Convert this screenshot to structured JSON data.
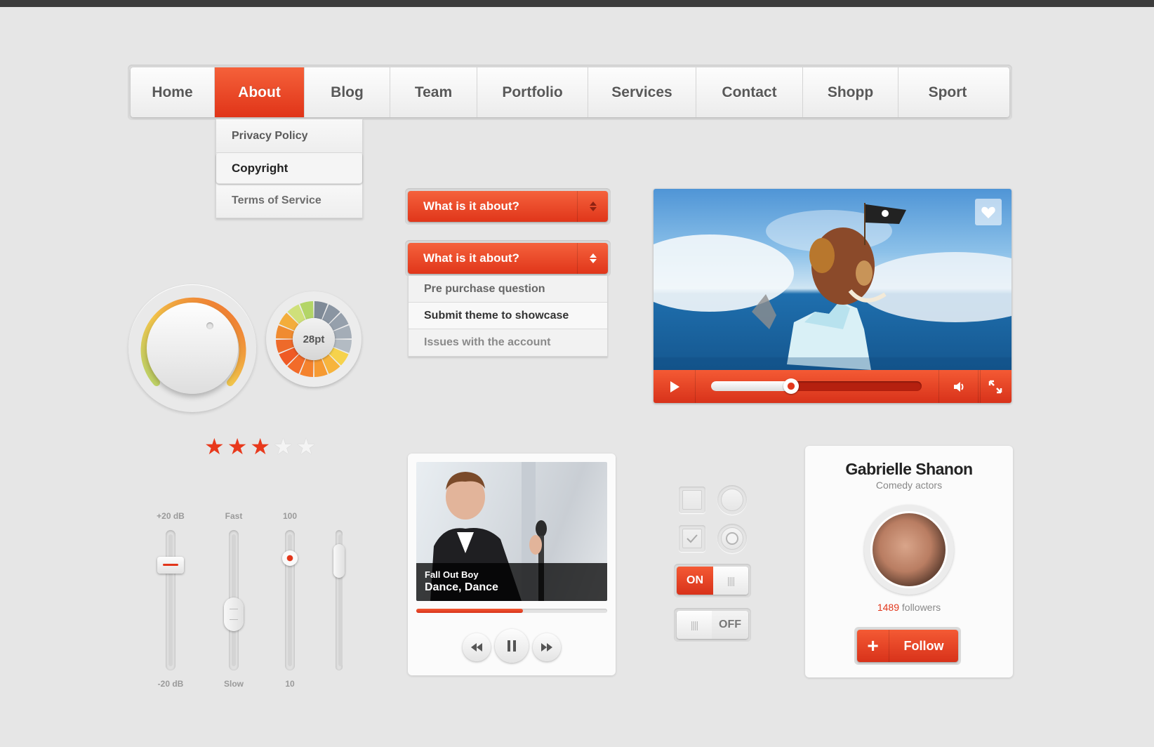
{
  "nav": {
    "items": [
      "Home",
      "About",
      "Blog",
      "Team",
      "Portfolio",
      "Services",
      "Contact",
      "Shopp",
      "Sport"
    ],
    "active_index": 1
  },
  "dropdown": {
    "items": [
      "Privacy Policy",
      "Copyright",
      "Terms of Service"
    ],
    "selected_index": 1
  },
  "select_closed": {
    "label": "What is it about?"
  },
  "select_open": {
    "label": "What is it about?",
    "options": [
      "Pre purchase question",
      "Submit theme to showcase",
      "Issues with the account"
    ],
    "selected_index": 1
  },
  "video": {
    "progress": 0.38
  },
  "knob": {
    "value_label": "28pt"
  },
  "rating": {
    "value": 3,
    "max": 5
  },
  "sliders": [
    {
      "top_label": "+20 dB",
      "bottom_label": "-20 dB",
      "level": 0.75
    },
    {
      "top_label": "Fast",
      "bottom_label": "Slow",
      "level": 0.4
    },
    {
      "top_label": "100",
      "bottom_label": "10",
      "level": 0.8
    },
    {
      "top_label": "",
      "bottom_label": "",
      "level": 0.78
    }
  ],
  "music": {
    "artist": "Fall Out Boy",
    "track": "Dance, Dance",
    "progress": 0.56
  },
  "checkboxes": [
    {
      "checked": false
    },
    {
      "checked": true
    }
  ],
  "radios": [
    {
      "checked": false
    },
    {
      "checked": true
    }
  ],
  "toggle_on": {
    "label": "ON"
  },
  "toggle_off": {
    "label": "OFF"
  },
  "profile": {
    "name": "Gabrielle Shanon",
    "role": "Comedy actors",
    "followers_count": "1489",
    "followers_label": "followers",
    "follow_label": "Follow"
  },
  "colors": {
    "accent": "#e8391c",
    "background": "#e6e6e6"
  }
}
